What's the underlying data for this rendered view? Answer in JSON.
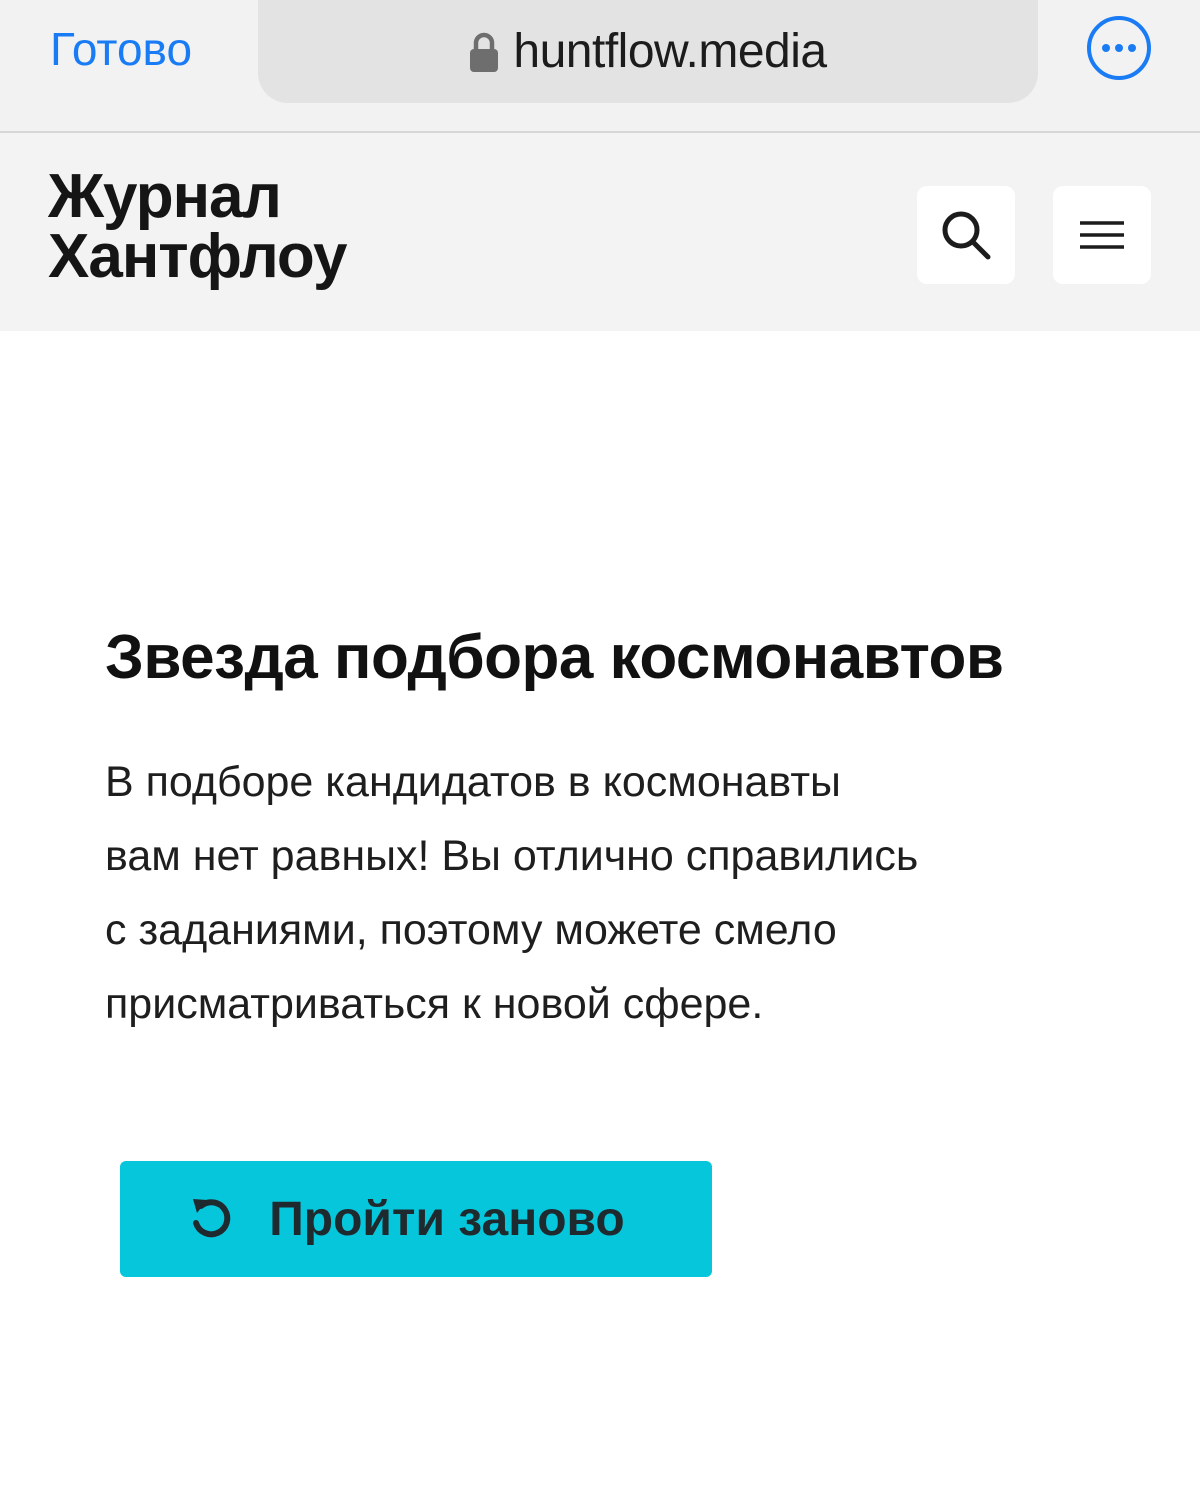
{
  "browser": {
    "done_label": "Готово",
    "url": "huntflow.media",
    "accent": "#1a7cf5"
  },
  "header": {
    "logo_line1": "Журнал",
    "logo_line2": "Хантфлоу"
  },
  "result": {
    "title": "Звезда подбора космонавтов",
    "description": "В подборе кандидатов в космонавты\nвам нет равных! Вы отлично справились\nс заданиями, поэтому можете смело\nприсматриваться к новой сфере."
  },
  "actions": {
    "retry_label": "Пройти заново",
    "retry_color": "#06c6dc"
  },
  "icons": {
    "lock": "lock-icon",
    "more": "ellipsis-circle-icon",
    "search": "search-icon",
    "menu": "hamburger-icon",
    "retry": "refresh-icon"
  }
}
